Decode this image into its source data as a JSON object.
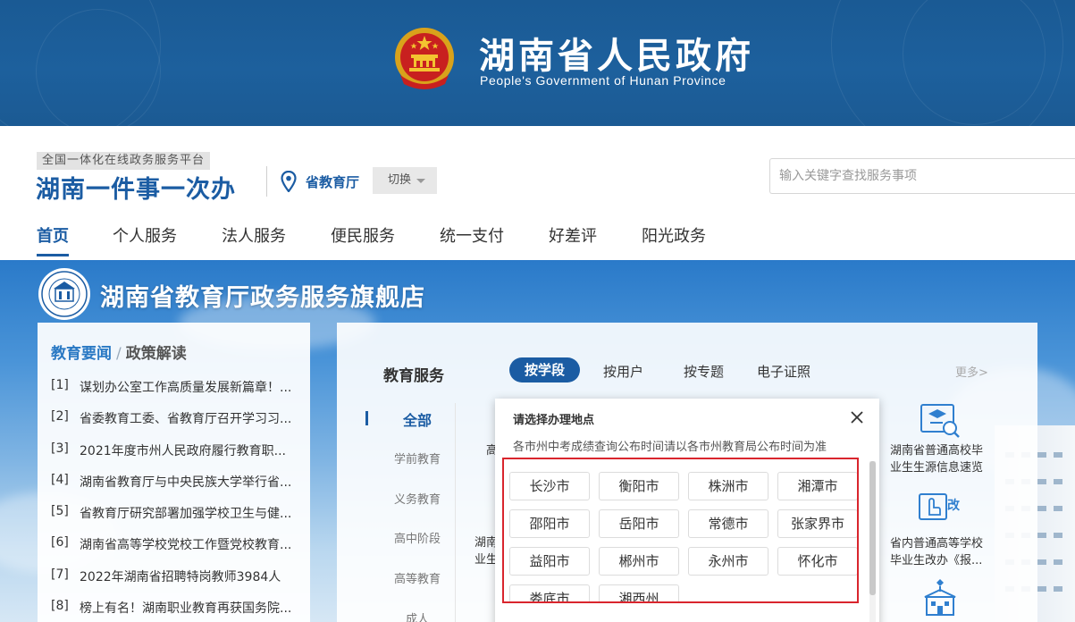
{
  "gov_banner": {
    "title": "湖南省人民政府",
    "subtitle": "People's Government of Hunan Province",
    "emblem_icon": "national-emblem-icon"
  },
  "platform": {
    "tag": "全国一体化在线政务服务平台",
    "name": "湖南一件事一次办",
    "location": "省教育厅",
    "switch_label": "切换",
    "location_icon": "map-pin-icon"
  },
  "search": {
    "placeholder": "输入关键字查找服务事项"
  },
  "main_nav": {
    "items": [
      {
        "label": "首页",
        "active": true
      },
      {
        "label": "个人服务"
      },
      {
        "label": "法人服务"
      },
      {
        "label": "便民服务"
      },
      {
        "label": "统一支付"
      },
      {
        "label": "好差评"
      },
      {
        "label": "阳光政务"
      }
    ]
  },
  "store": {
    "title": "湖南省教育厅政务服务旗舰店",
    "logo_icon": "education-department-seal-icon"
  },
  "news": {
    "tab_active": "教育要闻",
    "tab_separator": "/",
    "tab_other": "政策解读",
    "items": [
      {
        "index": "[1]",
        "text": "谋划办公室工作高质量发展新篇章！..."
      },
      {
        "index": "[2]",
        "text": "省委教育工委、省教育厅召开学习习..."
      },
      {
        "index": "[3]",
        "text": "2021年度市州人民政府履行教育职..."
      },
      {
        "index": "[4]",
        "text": "湖南省教育厅与中央民族大学举行省..."
      },
      {
        "index": "[5]",
        "text": "省教育厅研究部署加强学校卫生与健..."
      },
      {
        "index": "[6]",
        "text": "湖南省高等学校党校工作暨党校教育..."
      },
      {
        "index": "[7]",
        "text": "2022年湖南省招聘特岗教师3984人"
      },
      {
        "index": "[8]",
        "text": "榜上有名！湖南职业教育再获国务院..."
      }
    ]
  },
  "services": {
    "heading": "教育服务",
    "tabs": [
      {
        "label": "按学段",
        "active": true
      },
      {
        "label": "按用户"
      },
      {
        "label": "按专题"
      },
      {
        "label": "电子证照"
      }
    ],
    "more": "更多>",
    "stages": [
      {
        "label": "全部",
        "active": true
      },
      {
        "label": "学前教育"
      },
      {
        "label": "义务教育"
      },
      {
        "label": "高中阶段"
      },
      {
        "label": "高等教育"
      },
      {
        "label": "成人"
      }
    ],
    "cards": {
      "card1_left": "高",
      "card2_line1": "湖南",
      "card2_line2": "业生",
      "card_right1_line1": "湖南省普通高校毕",
      "card_right1_line2": "业生生源信息速览",
      "card_right2_line1": "省内普通高等学校",
      "card_right2_line2": "毕业生改办《报...",
      "card_right2_badge": "改"
    }
  },
  "modal": {
    "title": "请选择办理地点",
    "note": "各市州中考成绩查询公布时间请以各市州教育局公布时间为准",
    "cities": [
      "长沙市",
      "衡阳市",
      "株洲市",
      "湘潭市",
      "邵阳市",
      "岳阳市",
      "常德市",
      "张家界市",
      "益阳市",
      "郴州市",
      "永州市",
      "怀化市",
      "娄底市",
      "湘西州"
    ]
  },
  "colors": {
    "brand_blue": "#1b5ca3",
    "banner_blue": "#1d609d",
    "highlight_red": "#d9252d"
  }
}
